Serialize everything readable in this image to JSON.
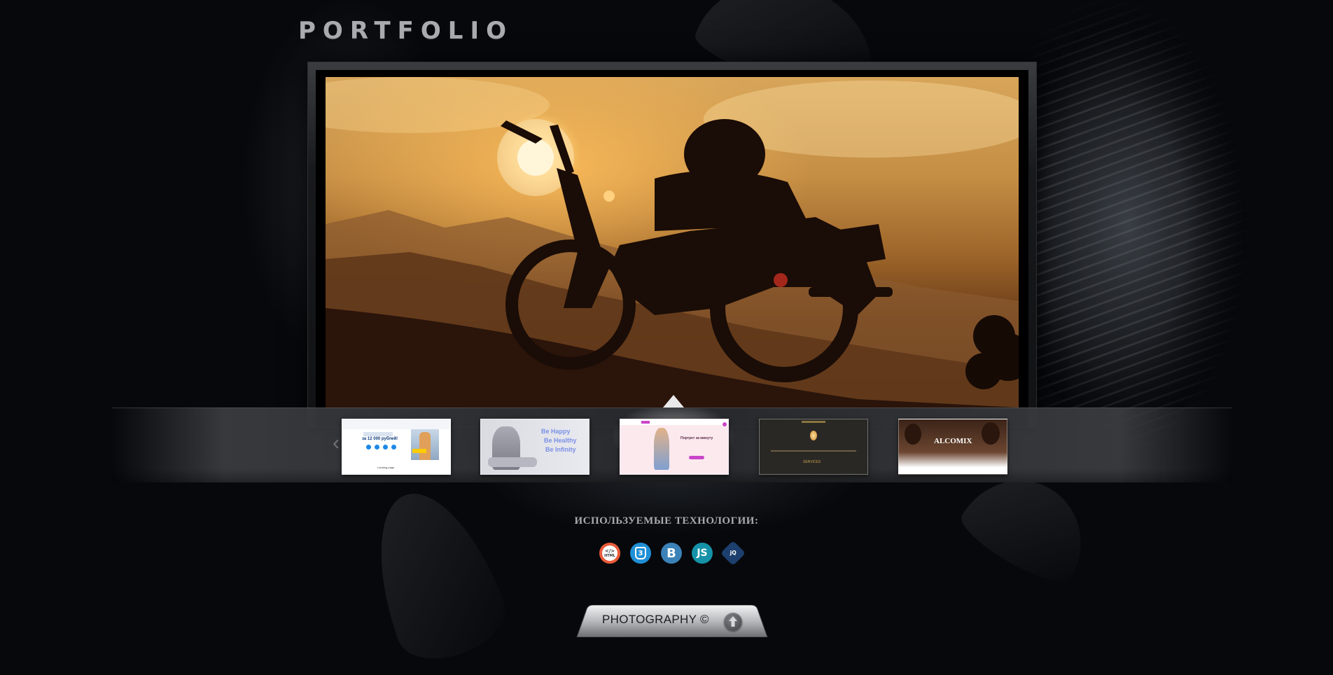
{
  "header": {
    "title": "PORTFOLIO"
  },
  "carousel": {
    "prev_icon": "chevron-left-icon",
    "next_icon": "chevron-right-icon",
    "prev_glyph": "‹",
    "next_glyph": "›",
    "active_index": 2,
    "thumbnails": [
      {
        "name": "thumb-landing-blue",
        "heading": "за 12 000 рублей!",
        "caption": "Landing page",
        "accent": "#1e88e5"
      },
      {
        "name": "thumb-be-happy",
        "lines": [
          "Be Happy",
          "Be Healthy",
          "Be Infinity"
        ],
        "accent": "#7b8fe6"
      },
      {
        "name": "thumb-pink-photo",
        "heading": "Портрет за минуту",
        "accent": "#c946c9"
      },
      {
        "name": "thumb-dark-services",
        "heading": "SERVICES",
        "accent": "#c8a24a"
      },
      {
        "name": "thumb-alcomix",
        "heading": "ALCOMIX",
        "accent": "#5a3a22"
      }
    ]
  },
  "technologies": {
    "label": "ИСПОЛЬЗУЕМЫЕ ТЕХНОЛОГИИ:",
    "items": [
      {
        "icon": "html5-icon",
        "text": "</>",
        "sub": "HTML",
        "color": "#e95a3a"
      },
      {
        "icon": "css3-icon",
        "text": "3",
        "color": "#1f8fd6"
      },
      {
        "icon": "bootstrap-icon",
        "text": "B",
        "color": "#3b82b8"
      },
      {
        "icon": "javascript-icon",
        "text": "JS",
        "color": "#1592a8"
      },
      {
        "icon": "jquery-icon",
        "text": "jQ",
        "color": "#1c3f6e"
      }
    ]
  },
  "footer": {
    "label": "PHOTOGRAPHY ©",
    "up_icon": "arrow-up-icon"
  }
}
